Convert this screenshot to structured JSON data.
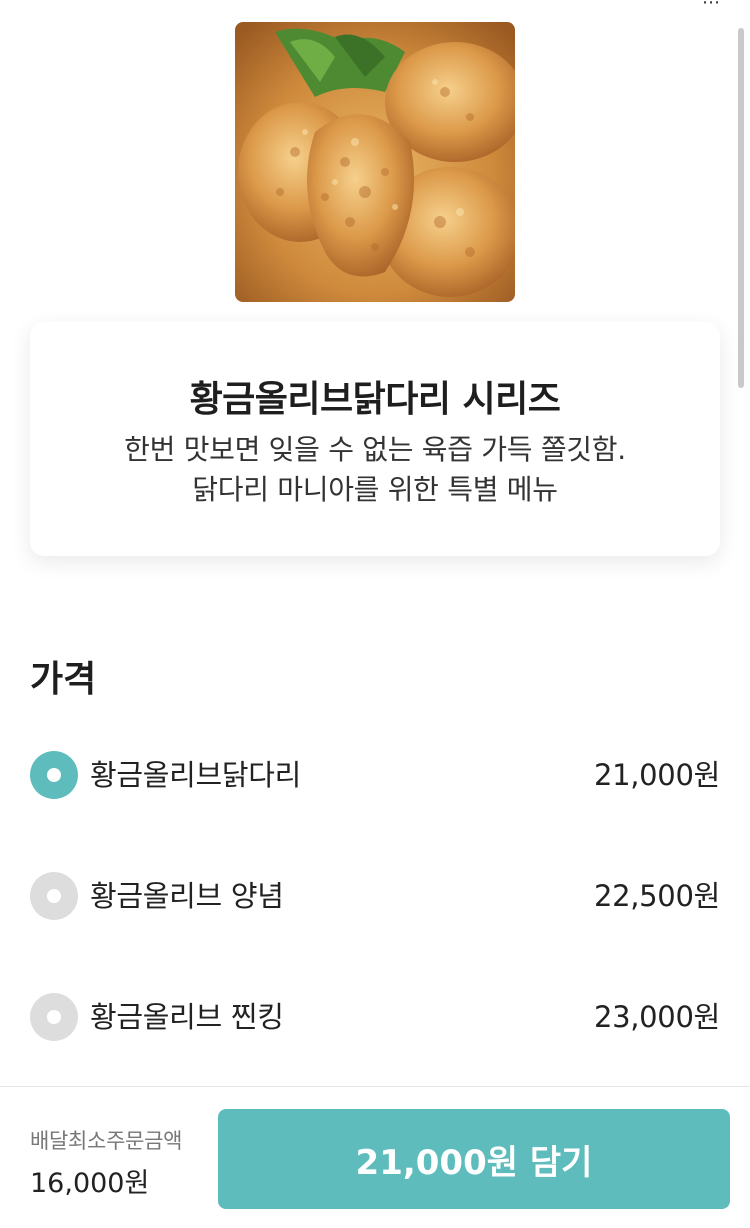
{
  "menu": {
    "title": "황금올리브닭다리 시리즈",
    "description_line1": "한번 맛보면 잊을 수 없는 육즙 가득 쫄깃함.",
    "description_line2": "닭다리 마니아를 위한 특별 메뉴"
  },
  "price_section": {
    "heading": "가격",
    "selected_index": 0,
    "options": [
      {
        "name": "황금올리브닭다리",
        "price": "21,000원",
        "selected": true
      },
      {
        "name": "황금올리브 양념",
        "price": "22,500원",
        "selected": false
      },
      {
        "name": "황금올리브 찐킹",
        "price": "23,000원",
        "selected": false
      }
    ]
  },
  "footer": {
    "min_order_label": "배달최소주문금액",
    "min_order_value": "16,000원",
    "cart_button_label": "21,000원 담기"
  },
  "colors": {
    "accent": "#5ebdbc",
    "radio_unselected": "#dddddd"
  },
  "icons": {
    "top_right": "share-icon"
  }
}
